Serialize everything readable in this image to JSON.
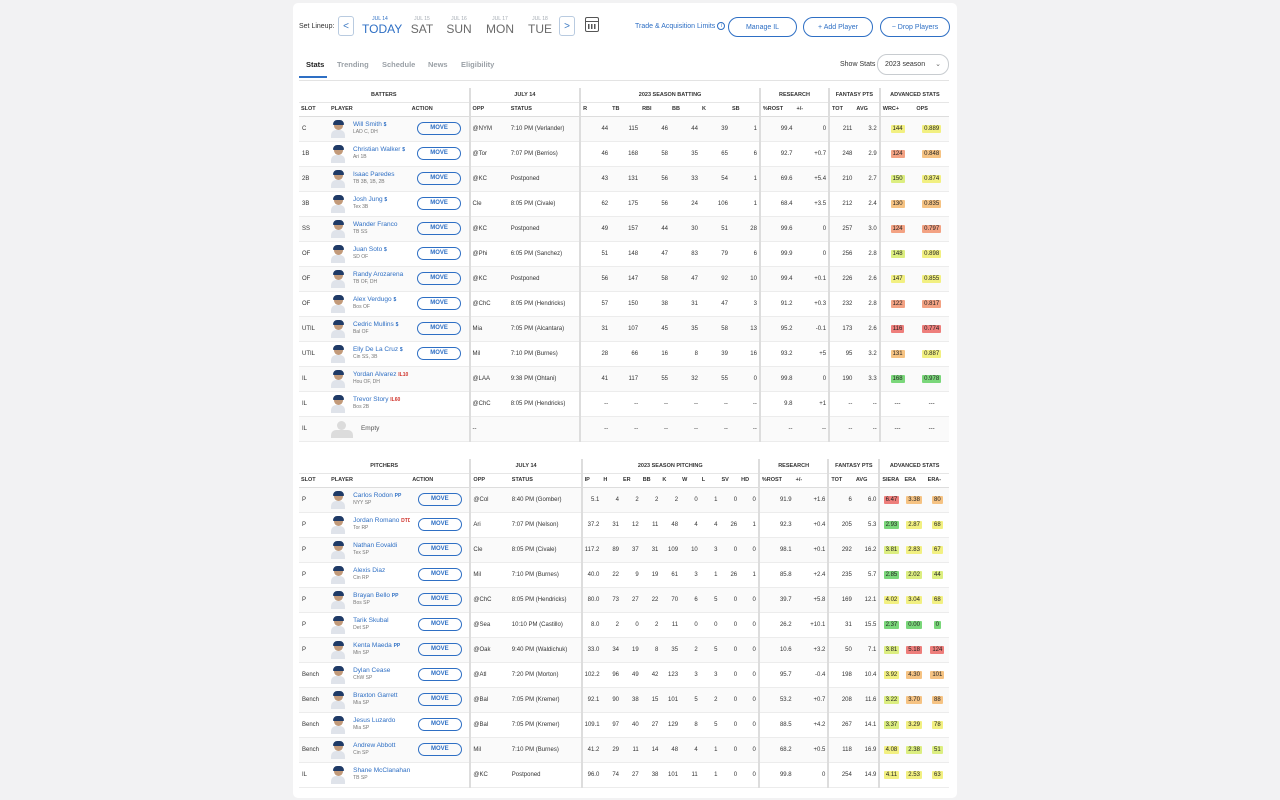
{
  "header": {
    "set_lineup": "Set Lineup:",
    "prev": "<",
    "next": ">",
    "trade_link": "Trade & Acquisition Limits",
    "trade_info": "i",
    "manage_il": "Manage IL",
    "add_player": "+ Add Player",
    "drop_players": "− Drop Players",
    "days": [
      {
        "date": "JUL 14",
        "name": "TODAY",
        "active": true
      },
      {
        "date": "JUL 15",
        "name": "SAT"
      },
      {
        "date": "JUL 16",
        "name": "SUN"
      },
      {
        "date": "JUL 17",
        "name": "MON"
      },
      {
        "date": "JUL 18",
        "name": "TUE"
      }
    ]
  },
  "tabs": [
    "Stats",
    "Trending",
    "Schedule",
    "News",
    "Eligibility"
  ],
  "show_stats": {
    "label": "Show Stats",
    "value": "2023 season"
  },
  "batters": {
    "groups": {
      "players": "BATTERS",
      "date": "JULY 14",
      "season": "2023 SEASON BATTING",
      "research": "RESEARCH",
      "fantasy": "FANTASY PTS",
      "advanced": "ADVANCED STATS"
    },
    "columns": {
      "slot": "SLOT",
      "player": "PLAYER",
      "action": "ACTION",
      "opp": "OPP",
      "status": "STATUS",
      "stats": [
        "R",
        "TB",
        "RBI",
        "BB",
        "K",
        "SB"
      ],
      "research": [
        "%ROST",
        "+/-"
      ],
      "fantasy": [
        "TOT",
        "AVG"
      ],
      "advanced": [
        "WRC+",
        "OPS"
      ]
    },
    "rows": [
      {
        "slot": "C",
        "name": "Will Smith",
        "flag": "$",
        "info": "LAD C, DH",
        "action": "MOVE",
        "opp": "@NYM",
        "status": "7:10 PM (Verlander)",
        "stats": [
          "44",
          "115",
          "46",
          "44",
          "39",
          "1"
        ],
        "rost": "99.4",
        "chg": "0",
        "tot": "211",
        "avg": "3.2",
        "adv": [
          "144",
          "0.889"
        ],
        "advc": [
          "#f2f081",
          "#f2f081"
        ]
      },
      {
        "slot": "1B",
        "name": "Christian Walker",
        "flag": "$",
        "info": "Ari 1B",
        "action": "MOVE",
        "opp": "@Tor",
        "status": "7:07 PM (Berrios)",
        "stats": [
          "46",
          "168",
          "58",
          "35",
          "65",
          "6"
        ],
        "rost": "92.7",
        "chg": "+0.7",
        "tot": "248",
        "avg": "2.9",
        "adv": [
          "124",
          "0.848"
        ],
        "advc": [
          "#f3a283",
          "#f6c383"
        ]
      },
      {
        "slot": "2B",
        "name": "Isaac Paredes",
        "flag": "",
        "info": "TB 3B, 1B, 2B",
        "action": "MOVE",
        "opp": "@KC",
        "status": "Postponed",
        "stats": [
          "43",
          "131",
          "56",
          "33",
          "54",
          "1"
        ],
        "rost": "69.6",
        "chg": "+5.4",
        "tot": "210",
        "avg": "2.7",
        "adv": [
          "150",
          "0.874"
        ],
        "advc": [
          "#dcee80",
          "#f2f081"
        ]
      },
      {
        "slot": "3B",
        "name": "Josh Jung",
        "flag": "$",
        "info": "Tex 3B",
        "action": "MOVE",
        "opp": "Cle",
        "status": "8:05 PM (Civale)",
        "stats": [
          "62",
          "175",
          "56",
          "24",
          "106",
          "1"
        ],
        "rost": "68.4",
        "chg": "+3.5",
        "tot": "212",
        "avg": "2.4",
        "adv": [
          "130",
          "0.835"
        ],
        "advc": [
          "#f6c383",
          "#f6c383"
        ]
      },
      {
        "slot": "SS",
        "name": "Wander Franco",
        "flag": "",
        "info": "TB SS",
        "action": "MOVE",
        "opp": "@KC",
        "status": "Postponed",
        "stats": [
          "49",
          "157",
          "44",
          "30",
          "51",
          "28"
        ],
        "rost": "99.6",
        "chg": "0",
        "tot": "257",
        "avg": "3.0",
        "adv": [
          "124",
          "0.797"
        ],
        "advc": [
          "#f3a283",
          "#f3a283"
        ]
      },
      {
        "slot": "OF",
        "name": "Juan Soto",
        "flag": "$",
        "info": "SD OF",
        "action": "MOVE",
        "opp": "@Phi",
        "status": "6:05 PM (Sanchez)",
        "stats": [
          "51",
          "148",
          "47",
          "83",
          "79",
          "6"
        ],
        "rost": "99.9",
        "chg": "0",
        "tot": "256",
        "avg": "2.8",
        "adv": [
          "148",
          "0.898"
        ],
        "advc": [
          "#dcee80",
          "#f2f081"
        ]
      },
      {
        "slot": "OF",
        "name": "Randy Arozarena",
        "flag": "",
        "info": "TB OF, DH",
        "action": "MOVE",
        "opp": "@KC",
        "status": "Postponed",
        "stats": [
          "56",
          "147",
          "58",
          "47",
          "92",
          "10"
        ],
        "rost": "99.4",
        "chg": "+0.1",
        "tot": "226",
        "avg": "2.6",
        "adv": [
          "147",
          "0.855"
        ],
        "advc": [
          "#f2f081",
          "#f2f081"
        ]
      },
      {
        "slot": "OF",
        "name": "Alex Verdugo",
        "flag": "$",
        "info": "Bos OF",
        "action": "MOVE",
        "opp": "@ChC",
        "status": "8:05 PM (Hendricks)",
        "stats": [
          "57",
          "150",
          "38",
          "31",
          "47",
          "3"
        ],
        "rost": "91.2",
        "chg": "+0.3",
        "tot": "232",
        "avg": "2.8",
        "adv": [
          "122",
          "0.817"
        ],
        "advc": [
          "#f3a283",
          "#f3a283"
        ]
      },
      {
        "slot": "UTIL",
        "name": "Cedric Mullins",
        "flag": "$",
        "info": "Bal OF",
        "action": "MOVE",
        "opp": "Mia",
        "status": "7:05 PM (Alcantara)",
        "stats": [
          "31",
          "107",
          "45",
          "35",
          "58",
          "13"
        ],
        "rost": "95.2",
        "chg": "-0.1",
        "tot": "173",
        "avg": "2.6",
        "adv": [
          "116",
          "0.774"
        ],
        "advc": [
          "#ee7e7b",
          "#ee7e7b"
        ]
      },
      {
        "slot": "UTIL",
        "name": "Elly De La Cruz",
        "flag": "$",
        "info": "Cin SS, 3B",
        "action": "MOVE",
        "opp": "Mil",
        "status": "7:10 PM (Burnes)",
        "stats": [
          "28",
          "66",
          "16",
          "8",
          "39",
          "16"
        ],
        "rost": "93.2",
        "chg": "+5",
        "tot": "95",
        "avg": "3.2",
        "adv": [
          "131",
          "0.887"
        ],
        "advc": [
          "#f6c383",
          "#f2f081"
        ]
      },
      {
        "slot": "IL",
        "name": "Yordan Alvarez",
        "flag": "IL10",
        "info": "Hou OF, DH",
        "action": "",
        "opp": "@LAA",
        "status": "9:38 PM (Ohtani)",
        "stats": [
          "41",
          "117",
          "55",
          "32",
          "55",
          "0"
        ],
        "rost": "99.8",
        "chg": "0",
        "tot": "190",
        "avg": "3.3",
        "adv": [
          "168",
          "0.978"
        ],
        "advc": [
          "#7ad77a",
          "#7ad77a"
        ]
      },
      {
        "slot": "IL",
        "name": "Trevor Story",
        "flag": "IL60",
        "info": "Bos 2B",
        "action": "",
        "opp": "@ChC",
        "status": "8:05 PM (Hendricks)",
        "stats": [
          "--",
          "--",
          "--",
          "--",
          "--",
          "--"
        ],
        "rost": "9.8",
        "chg": "+1",
        "tot": "--",
        "avg": "--",
        "adv": [
          "---",
          "---"
        ],
        "advc": [
          "",
          ""
        ]
      },
      {
        "slot": "IL",
        "name": "Empty",
        "flag": "",
        "info": "",
        "action": "",
        "opp": "--",
        "status": "",
        "stats": [
          "--",
          "--",
          "--",
          "--",
          "--",
          "--"
        ],
        "rost": "--",
        "chg": "--",
        "tot": "--",
        "avg": "--",
        "adv": [
          "---",
          "---"
        ],
        "advc": [
          "",
          ""
        ],
        "empty": true
      }
    ]
  },
  "pitchers": {
    "groups": {
      "players": "PITCHERS",
      "date": "JULY 14",
      "season": "2023 SEASON PITCHING",
      "research": "RESEARCH",
      "fantasy": "FANTASY PTS",
      "advanced": "ADVANCED STATS"
    },
    "columns": {
      "slot": "SLOT",
      "player": "PLAYER",
      "action": "ACTION",
      "opp": "OPP",
      "status": "STATUS",
      "stats": [
        "IP",
        "H",
        "ER",
        "BB",
        "K",
        "W",
        "L",
        "SV",
        "HD"
      ],
      "research": [
        "%ROST",
        "+/-"
      ],
      "fantasy": [
        "TOT",
        "AVG"
      ],
      "advanced": [
        "SIERA",
        "ERA",
        "ERA-"
      ]
    },
    "rows": [
      {
        "slot": "P",
        "name": "Carlos Rodon",
        "flag": "PP",
        "info": "NYY SP",
        "action": "MOVE",
        "opp": "@Col",
        "status": "8:40 PM (Gomber)",
        "stats": [
          "5.1",
          "4",
          "2",
          "2",
          "2",
          "0",
          "1",
          "0",
          "0"
        ],
        "rost": "91.9",
        "chg": "+1.6",
        "tot": "6",
        "avg": "6.0",
        "adv": [
          "6.47",
          "3.38",
          "80"
        ],
        "advc": [
          "#ee7e7b",
          "#f6c383",
          "#f6c383"
        ]
      },
      {
        "slot": "P",
        "name": "Jordan Romano",
        "flag": "DTD",
        "info": "Tor RP",
        "action": "MOVE",
        "opp": "Ari",
        "status": "7:07 PM (Nelson)",
        "stats": [
          "37.2",
          "31",
          "12",
          "11",
          "48",
          "4",
          "4",
          "26",
          "1"
        ],
        "rost": "92.3",
        "chg": "+0.4",
        "tot": "205",
        "avg": "5.3",
        "adv": [
          "2.93",
          "2.87",
          "68"
        ],
        "advc": [
          "#7ad77a",
          "#f2f081",
          "#f2f081"
        ]
      },
      {
        "slot": "P",
        "name": "Nathan Eovaldi",
        "flag": "",
        "info": "Tex SP",
        "action": "MOVE",
        "opp": "Cle",
        "status": "8:05 PM (Civale)",
        "stats": [
          "117.2",
          "89",
          "37",
          "31",
          "109",
          "10",
          "3",
          "0",
          "0"
        ],
        "rost": "98.1",
        "chg": "+0.1",
        "tot": "292",
        "avg": "16.2",
        "adv": [
          "3.81",
          "2.83",
          "67"
        ],
        "advc": [
          "#dcee80",
          "#f2f081",
          "#f2f081"
        ]
      },
      {
        "slot": "P",
        "name": "Alexis Diaz",
        "flag": "",
        "info": "Cin RP",
        "action": "MOVE",
        "opp": "Mil",
        "status": "7:10 PM (Burnes)",
        "stats": [
          "40.0",
          "22",
          "9",
          "19",
          "61",
          "3",
          "1",
          "26",
          "1"
        ],
        "rost": "85.8",
        "chg": "+2.4",
        "tot": "235",
        "avg": "5.7",
        "adv": [
          "2.85",
          "2.02",
          "44"
        ],
        "advc": [
          "#7ad77a",
          "#dcee80",
          "#dcee80"
        ]
      },
      {
        "slot": "P",
        "name": "Brayan Bello",
        "flag": "PP",
        "info": "Bos SP",
        "action": "MOVE",
        "opp": "@ChC",
        "status": "8:05 PM (Hendricks)",
        "stats": [
          "80.0",
          "73",
          "27",
          "22",
          "70",
          "6",
          "5",
          "0",
          "0"
        ],
        "rost": "39.7",
        "chg": "+5.8",
        "tot": "169",
        "avg": "12.1",
        "adv": [
          "4.02",
          "3.04",
          "68"
        ],
        "advc": [
          "#f2f081",
          "#f2f081",
          "#f2f081"
        ]
      },
      {
        "slot": "P",
        "name": "Tarik Skubal",
        "flag": "",
        "info": "Det SP",
        "action": "MOVE",
        "opp": "@Sea",
        "status": "10:10 PM (Castillo)",
        "stats": [
          "8.0",
          "2",
          "0",
          "2",
          "11",
          "0",
          "0",
          "0",
          "0"
        ],
        "rost": "26.2",
        "chg": "+10.1",
        "tot": "31",
        "avg": "15.5",
        "adv": [
          "2.37",
          "0.00",
          "0"
        ],
        "advc": [
          "#7ad77a",
          "#7ad77a",
          "#7ad77a"
        ]
      },
      {
        "slot": "P",
        "name": "Kenta Maeda",
        "flag": "PP",
        "info": "Min SP",
        "action": "MOVE",
        "opp": "@Oak",
        "status": "9:40 PM (Waldichuk)",
        "stats": [
          "33.0",
          "34",
          "19",
          "8",
          "35",
          "2",
          "5",
          "0",
          "0"
        ],
        "rost": "10.6",
        "chg": "+3.2",
        "tot": "50",
        "avg": "7.1",
        "adv": [
          "3.81",
          "5.18",
          "124"
        ],
        "advc": [
          "#dcee80",
          "#ee7e7b",
          "#ee7e7b"
        ]
      },
      {
        "slot": "Bench",
        "name": "Dylan Cease",
        "flag": "",
        "info": "ChW SP",
        "action": "MOVE",
        "opp": "@Atl",
        "status": "7:20 PM (Morton)",
        "stats": [
          "102.2",
          "96",
          "49",
          "42",
          "123",
          "3",
          "3",
          "0",
          "0"
        ],
        "rost": "95.7",
        "chg": "-0.4",
        "tot": "198",
        "avg": "10.4",
        "adv": [
          "3.92",
          "4.30",
          "101"
        ],
        "advc": [
          "#f2f081",
          "#f6c383",
          "#f6c383"
        ]
      },
      {
        "slot": "Bench",
        "name": "Braxton Garrett",
        "flag": "",
        "info": "Mia SP",
        "action": "MOVE",
        "opp": "@Bal",
        "status": "7:05 PM (Kremer)",
        "stats": [
          "92.1",
          "90",
          "38",
          "15",
          "101",
          "5",
          "2",
          "0",
          "0"
        ],
        "rost": "53.2",
        "chg": "+0.7",
        "tot": "208",
        "avg": "11.6",
        "adv": [
          "3.22",
          "3.70",
          "88"
        ],
        "advc": [
          "#dcee80",
          "#f6c383",
          "#f6c383"
        ]
      },
      {
        "slot": "Bench",
        "name": "Jesus Luzardo",
        "flag": "",
        "info": "Mia SP",
        "action": "MOVE",
        "opp": "@Bal",
        "status": "7:05 PM (Kremer)",
        "stats": [
          "109.1",
          "97",
          "40",
          "27",
          "129",
          "8",
          "5",
          "0",
          "0"
        ],
        "rost": "88.5",
        "chg": "+4.2",
        "tot": "267",
        "avg": "14.1",
        "adv": [
          "3.37",
          "3.29",
          "78"
        ],
        "advc": [
          "#dcee80",
          "#f2f081",
          "#f2f081"
        ]
      },
      {
        "slot": "Bench",
        "name": "Andrew Abbott",
        "flag": "",
        "info": "Cin SP",
        "action": "MOVE",
        "opp": "Mil",
        "status": "7:10 PM (Burnes)",
        "stats": [
          "41.2",
          "29",
          "11",
          "14",
          "48",
          "4",
          "1",
          "0",
          "0"
        ],
        "rost": "68.2",
        "chg": "+0.5",
        "tot": "118",
        "avg": "16.9",
        "adv": [
          "4.08",
          "2.38",
          "51"
        ],
        "advc": [
          "#f2f081",
          "#dcee80",
          "#dcee80"
        ]
      },
      {
        "slot": "IL",
        "name": "Shane McClanahan",
        "flag": "IL15",
        "info": "TB SP",
        "action": "",
        "opp": "@KC",
        "status": "Postponed",
        "stats": [
          "96.0",
          "74",
          "27",
          "38",
          "101",
          "11",
          "1",
          "0",
          "0"
        ],
        "rost": "99.8",
        "chg": "0",
        "tot": "254",
        "avg": "14.9",
        "adv": [
          "4.11",
          "2.53",
          "63"
        ],
        "advc": [
          "#f2f081",
          "#f2f081",
          "#f2f081"
        ]
      }
    ]
  }
}
